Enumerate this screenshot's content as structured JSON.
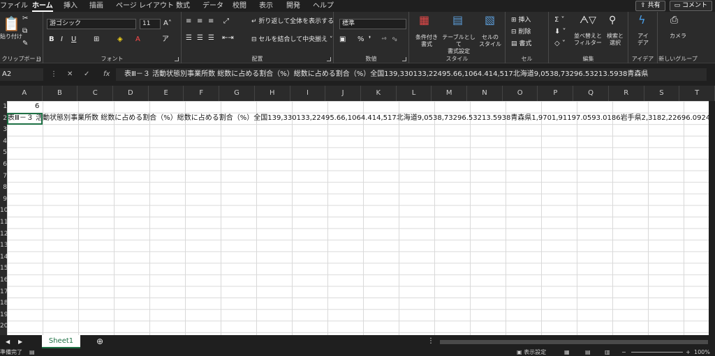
{
  "menu": {
    "tabs": [
      "ファイル",
      "ホーム",
      "挿入",
      "描画",
      "ページ レイアウト",
      "数式",
      "データ",
      "校閲",
      "表示",
      "開発",
      "ヘルプ"
    ],
    "active_tab": "ホーム",
    "share_label": "共有",
    "comment_label": "コメント"
  },
  "ribbon": {
    "clipboard": {
      "paste_label": "貼り付け",
      "group_label": "クリップボード"
    },
    "font": {
      "font_name": "游ゴシック",
      "font_size": "11",
      "group_label": "フォント",
      "bold": "B",
      "italic": "I",
      "underline": "U"
    },
    "alignment": {
      "wrap_text_label": "折り返して全体を表示する",
      "merge_center_label": "セルを結合して中央揃え",
      "group_label": "配置"
    },
    "number": {
      "format": "標準",
      "group_label": "数値"
    },
    "styles": {
      "conditional_label": "条件付き\n書式",
      "table_label": "テーブルとして\n書式設定",
      "cell_styles_label": "セルの\nスタイル",
      "group_label": "スタイル"
    },
    "cells": {
      "insert_label": "挿入",
      "delete_label": "削除",
      "format_label": "書式",
      "group_label": "セル"
    },
    "editing": {
      "sort_label": "並べ替えと\nフィルター",
      "find_label": "検索と\n選択",
      "group_label": "編集"
    },
    "ideas": {
      "label": "アイ\nデア",
      "group_label": "アイデア"
    },
    "camera": {
      "label": "カメラ",
      "group_label": "新しいグループ"
    }
  },
  "formula_bar": {
    "name_box": "A2",
    "fx": "fx",
    "content": "表Ⅲ－３ 活動状態別事業所数 総数に占める割合（%）総数に占める割合（%）全国139,330133,22495.66,1064.414,517北海道9,0538,73296.53213.5938青森県"
  },
  "columns": [
    "A",
    "B",
    "C",
    "D",
    "E",
    "F",
    "G",
    "H",
    "I",
    "J",
    "K",
    "L",
    "M",
    "N",
    "O",
    "P",
    "Q",
    "R",
    "S",
    "T"
  ],
  "rows": [
    "1",
    "2",
    "3",
    "4",
    "5",
    "6",
    "7",
    "8",
    "9",
    "10",
    "11",
    "12",
    "13",
    "14",
    "15",
    "16",
    "17",
    "18",
    "19",
    "20"
  ],
  "cells": {
    "a1": "6",
    "a2": "表Ⅲ－３ 活動状態別事業所数 総数に占める割合（%）総数に占める割合（%）全国139,330133,22495.66,1064.414,517北海道9,0538,73296.53213.5938青森県1,9701,91197.0593.0186岩手県2,3182,22696.0924."
  },
  "sheet_tabs": [
    "Sheet1"
  ],
  "status": {
    "ready": "準備完了",
    "display_settings": "表示設定",
    "zoom": "100%"
  }
}
